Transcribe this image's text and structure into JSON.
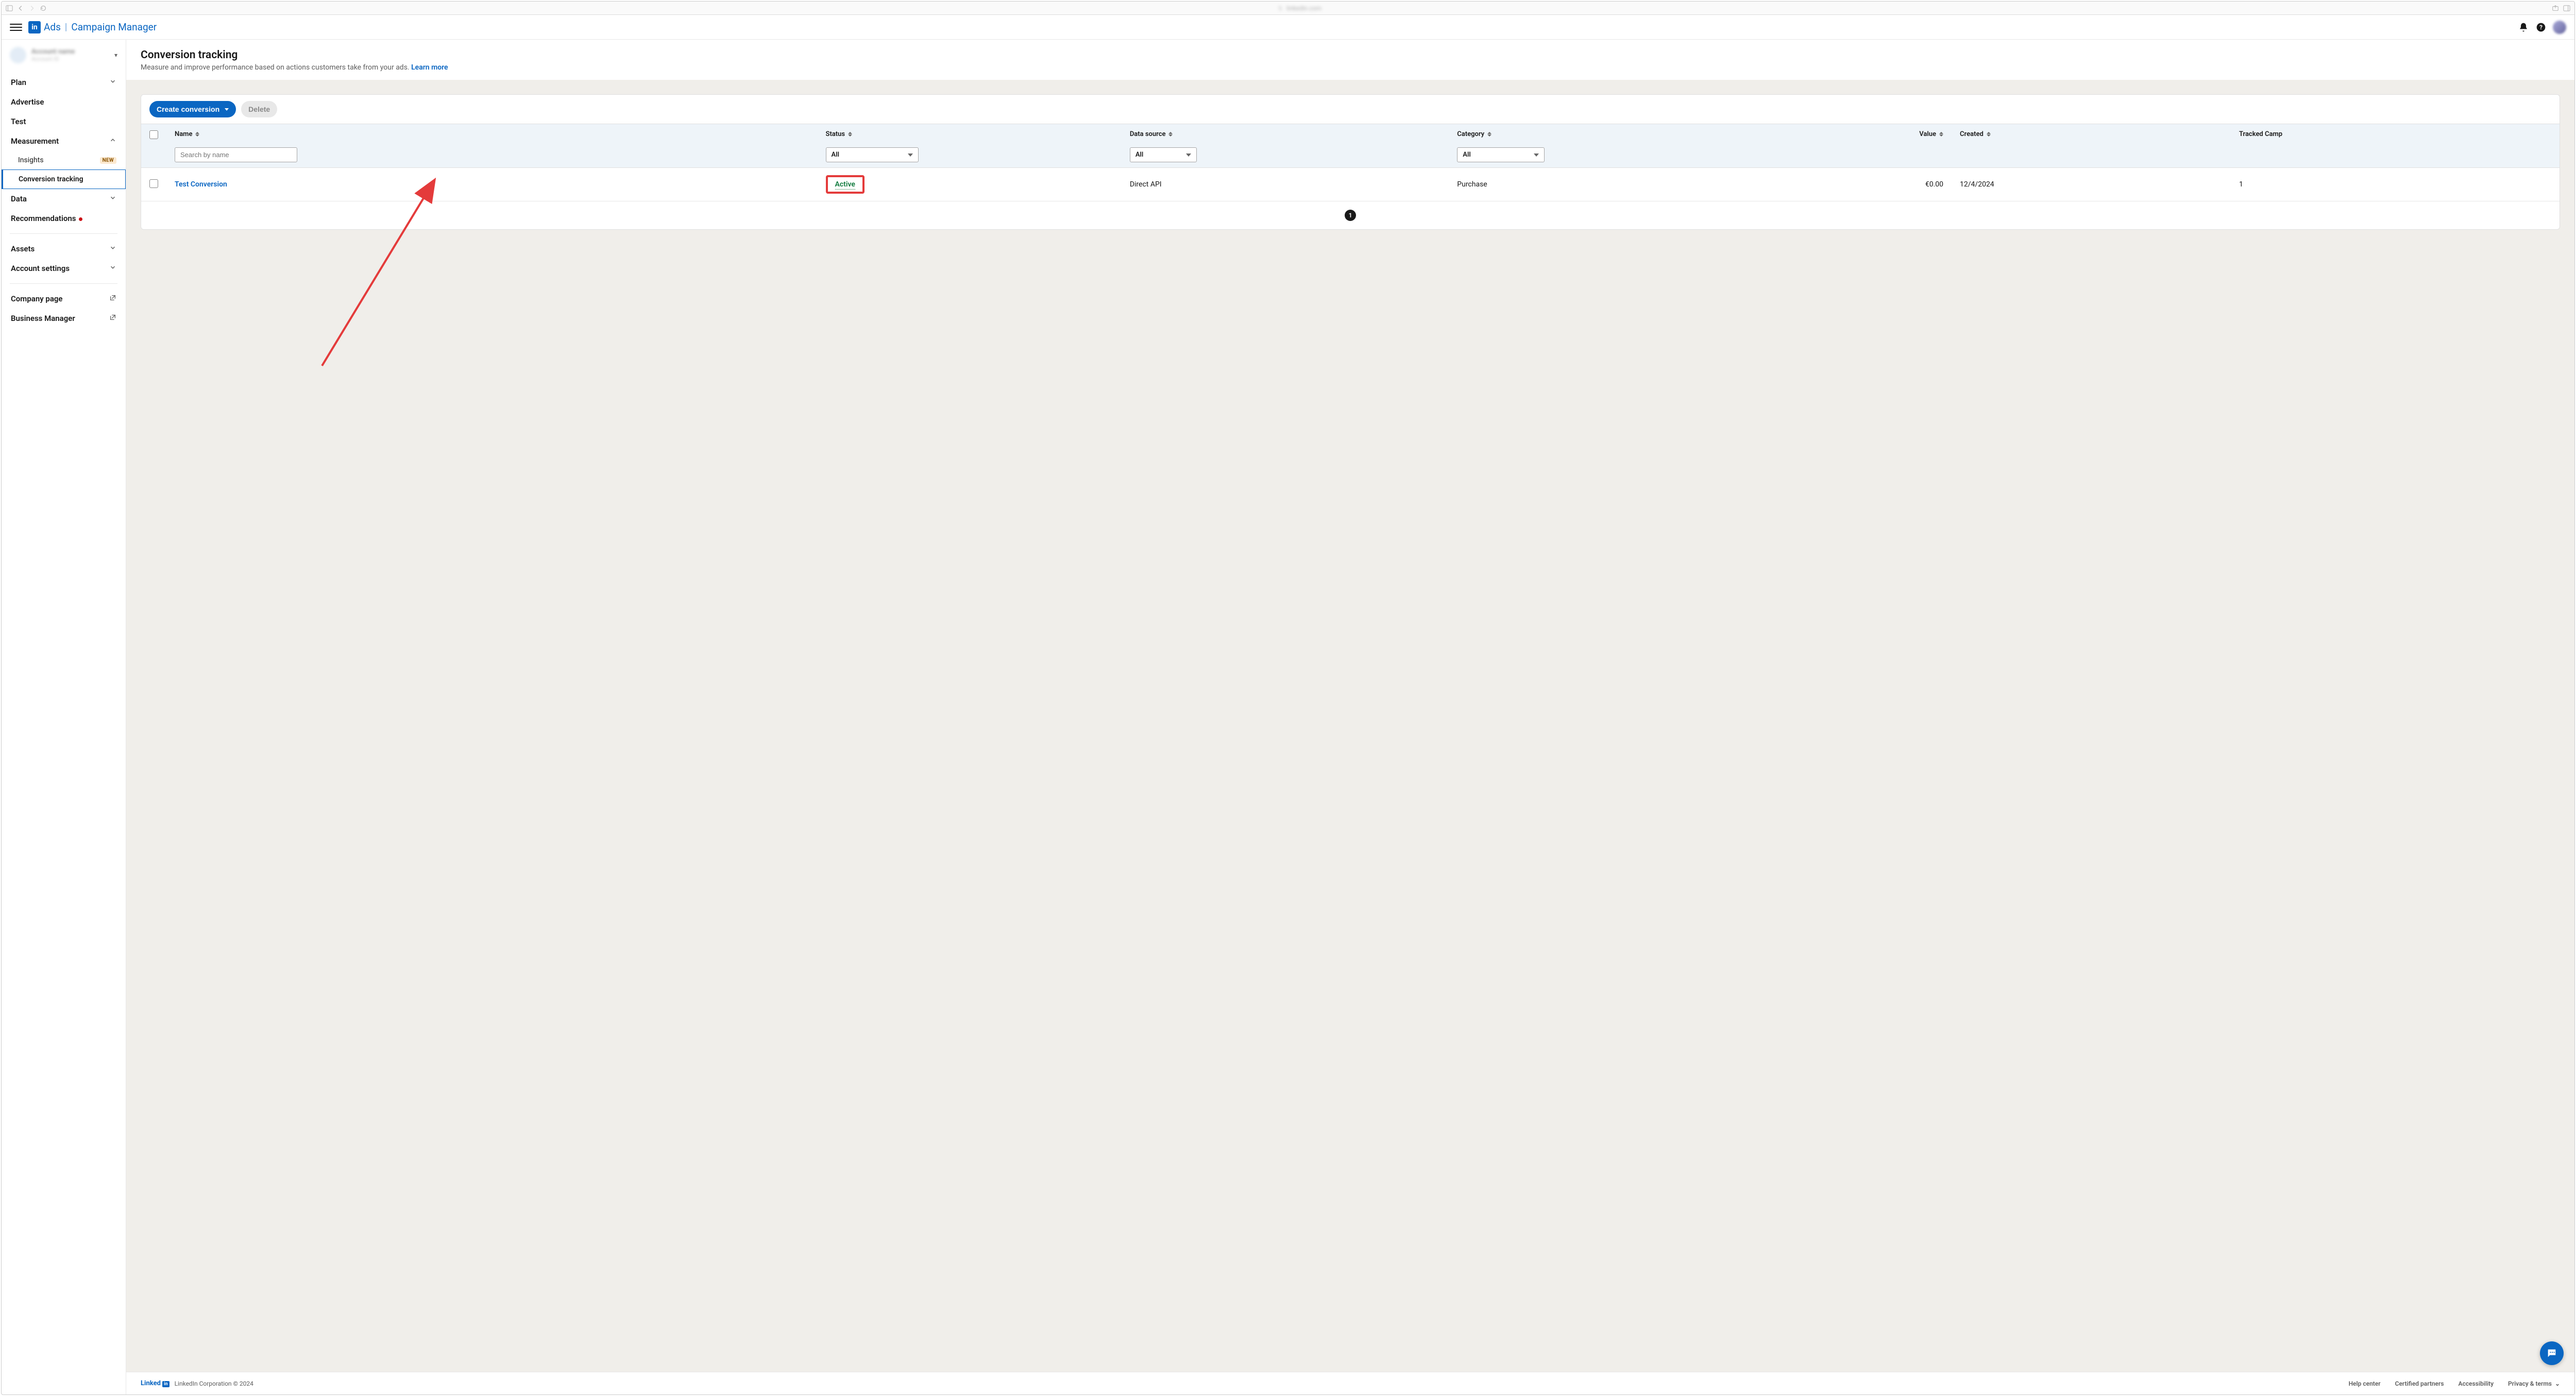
{
  "app": {
    "ads": "Ads",
    "cm": "Campaign Manager"
  },
  "sidebar": {
    "plan": "Plan",
    "advertise": "Advertise",
    "test": "Test",
    "measurement": "Measurement",
    "insights": "Insights",
    "insights_badge": "NEW",
    "conversion_tracking": "Conversion tracking",
    "data": "Data",
    "recommendations": "Recommendations",
    "assets": "Assets",
    "account_settings": "Account settings",
    "company_page": "Company page",
    "business_manager": "Business Manager"
  },
  "page": {
    "title": "Conversion tracking",
    "subtitle": "Measure and improve performance based on actions customers take from your ads. ",
    "learn_more": "Learn more"
  },
  "toolbar": {
    "create": "Create conversion",
    "delete": "Delete"
  },
  "table": {
    "cols": {
      "name": "Name",
      "status": "Status",
      "data_source": "Data source",
      "category": "Category",
      "value": "Value",
      "created": "Created",
      "tracked": "Tracked Camp"
    },
    "filters": {
      "search_placeholder": "Search by name",
      "all": "All"
    },
    "rows": [
      {
        "name": "Test Conversion",
        "status": "Active",
        "data_source": "Direct API",
        "category": "Purchase",
        "value": "€0.00",
        "created": "12/4/2024",
        "tracked": "1"
      }
    ]
  },
  "pagination": {
    "page": "1"
  },
  "footer": {
    "brand": "Linked",
    "box": "in",
    "copyright": "LinkedIn Corporation © 2024",
    "help": "Help center",
    "partners": "Certified partners",
    "accessibility": "Accessibility",
    "privacy": "Privacy & terms"
  }
}
